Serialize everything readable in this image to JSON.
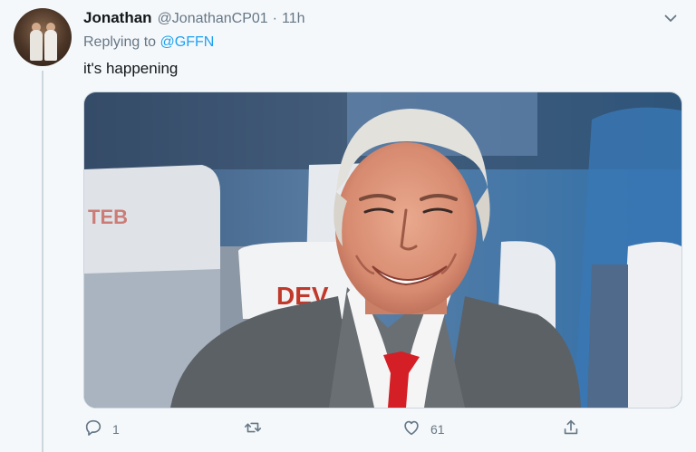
{
  "tweet": {
    "author_name": "Jonathan",
    "author_handle": "@JonathanCP01",
    "separator": "·",
    "time": "11h",
    "replying_prefix": "Replying to",
    "replying_to": "@GFFN",
    "text": "it's happening",
    "media_seat_text": "DEV"
  },
  "actions": {
    "reply_count": "1",
    "retweet_count": "",
    "like_count": "61"
  },
  "icons": {
    "more": "chevron-down-icon",
    "reply": "comment-icon",
    "retweet": "retweet-icon",
    "like": "heart-icon",
    "share": "share-icon"
  },
  "colors": {
    "background": "#f5f8fa",
    "text": "#14171a",
    "muted": "#657786",
    "link": "#1da1f2"
  }
}
